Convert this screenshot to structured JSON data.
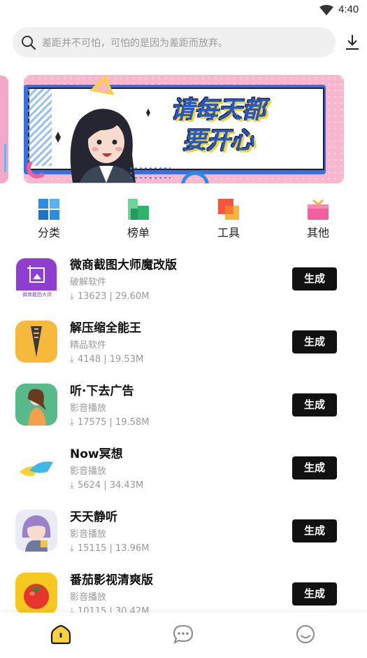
{
  "status_bar": {
    "time": "4:40",
    "wifi_icon": "wifi-icon"
  },
  "search": {
    "placeholder": "差距并不可怕，可怕的是因为差距而放弃。",
    "icon": "search-icon",
    "download_icon": "download-icon"
  },
  "banner": {
    "line1": "请每天都",
    "line2": "要开心"
  },
  "categories": [
    {
      "label": "分类",
      "icon": "category-grid-icon",
      "color": "#2d8ce0"
    },
    {
      "label": "榜单",
      "icon": "ranking-icon",
      "color": "#2fb36b"
    },
    {
      "label": "工具",
      "icon": "tools-icon",
      "color": "#f2583e"
    },
    {
      "label": "其他",
      "icon": "gift-icon",
      "color": "#f0609c"
    }
  ],
  "apps": [
    {
      "name": "微商截图大师魔改版",
      "category": "破解软件",
      "downloads": "13623",
      "size": "29.60M",
      "button": "生成",
      "icon_caption": "微商截图大师"
    },
    {
      "name": "解压缩全能王",
      "category": "精品软件",
      "downloads": "4148",
      "size": "19.53M",
      "button": "生成"
    },
    {
      "name": "听·下去广告",
      "category": "影音播放",
      "downloads": "17575",
      "size": "19.58M",
      "button": "生成"
    },
    {
      "name": "Now冥想",
      "category": "影音播放",
      "downloads": "5624",
      "size": "34.43M",
      "button": "生成"
    },
    {
      "name": "天天静听",
      "category": "影音播放",
      "downloads": "15115",
      "size": "13.96M",
      "button": "生成"
    },
    {
      "name": "番茄影视清爽版",
      "category": "影音播放",
      "downloads": "10115",
      "size": "30.42M",
      "button": "生成"
    }
  ],
  "bottom_nav": [
    {
      "icon": "home-icon",
      "active": true
    },
    {
      "icon": "message-icon",
      "active": false
    },
    {
      "icon": "profile-smile-icon",
      "active": false
    }
  ],
  "colors": {
    "accent": "#f7d23c",
    "button": "#111111",
    "banner_blue": "#2457c9",
    "banner_pink": "#f8b6cf"
  }
}
